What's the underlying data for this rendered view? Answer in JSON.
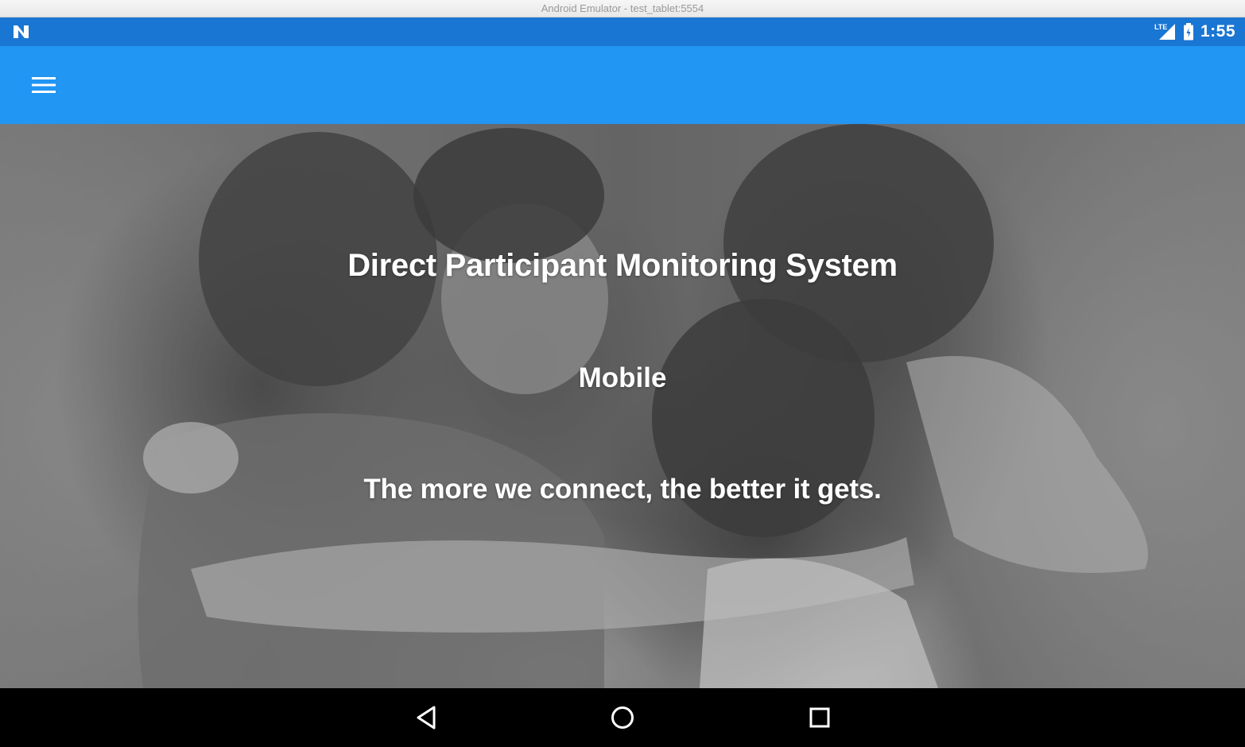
{
  "window": {
    "title": "Android Emulator - test_tablet:5554"
  },
  "status_bar": {
    "notification_icon": "n-logo-icon",
    "network_label": "LTE",
    "signal_icon": "signal-icon",
    "battery_icon": "battery-icon",
    "time": "1:55",
    "color": "#1976d2"
  },
  "app_bar": {
    "menu_icon": "hamburger-menu-icon",
    "color": "#2196f3"
  },
  "hero": {
    "title": "Direct Participant Monitoring System",
    "subtitle": "Mobile",
    "tagline": "The more we connect, the better it gets.",
    "image_description_icon": "background-photo"
  },
  "nav_bar": {
    "back_icon": "back-triangle-icon",
    "home_icon": "home-circle-icon",
    "recents_icon": "recents-square-icon",
    "color": "#000000"
  }
}
